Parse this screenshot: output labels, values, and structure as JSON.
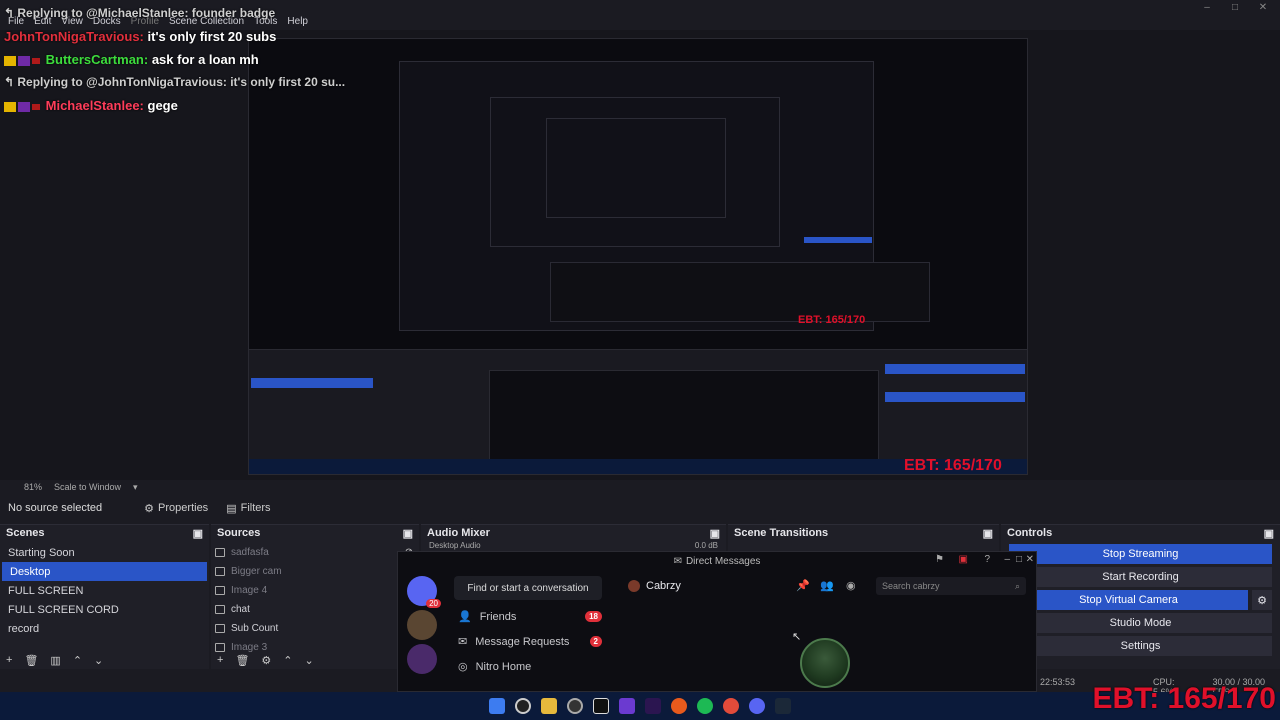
{
  "window": {
    "title": ""
  },
  "menu": {
    "items": [
      "File",
      "Edit",
      "View",
      "Docks",
      "Profile",
      "Scene Collection",
      "Tools",
      "Help"
    ]
  },
  "chat": {
    "reply1": "Replying to @MichaelStanlee: founder badge",
    "line1_user": "JohnTonNigaTravious:",
    "line1_msg": "it's only first 20 subs",
    "line2_user": "ButtersCartman:",
    "line2_msg": "ask for a loan mh",
    "reply2": "Replying to @JohnTonNigaTravious: it's only first 20 su...",
    "line3_user": "MichaelStanlee:",
    "line3_msg": "gege"
  },
  "preview": {
    "ebt_small": "EBT: 165/170",
    "zoom": "81%",
    "scale_mode": "Scale to Window"
  },
  "source_bar": {
    "no_source": "No source selected",
    "properties": "Properties",
    "filters": "Filters"
  },
  "scenes": {
    "title": "Scenes",
    "items": [
      "Starting Soon",
      "Desktop",
      "FULL SCREEN",
      "FULL SCREEN CORD",
      "record"
    ],
    "selected": "Desktop"
  },
  "sources": {
    "title": "Sources",
    "items": [
      "sadfasfa",
      "Bigger cam",
      "Image 4",
      "chat",
      "Sub Count",
      "Image 3"
    ]
  },
  "audio_mixer": {
    "title": "Audio Mixer",
    "first_channel": "Desktop Audio",
    "level": "0.0 dB"
  },
  "scene_transitions": {
    "title": "Scene Transitions"
  },
  "controls": {
    "title": "Controls",
    "buttons": [
      "Stop Streaming",
      "Start Recording",
      "Stop Virtual Camera",
      "Studio Mode",
      "Settings"
    ]
  },
  "discord": {
    "title": "Direct Messages",
    "find": "Find or start a conversation",
    "nav": [
      {
        "label": "Friends",
        "badge": "18"
      },
      {
        "label": "Message Requests",
        "badge": "2"
      },
      {
        "label": "Nitro Home",
        "badge": ""
      }
    ],
    "dm_name": "Cabrzy",
    "search_placeholder": "Search cabrzy",
    "server_badge": "20"
  },
  "status": {
    "time": "22:53:53",
    "cpu": "CPU: 5.6%",
    "fps": "30.00 / 30.00 FPS"
  },
  "overlay": {
    "ebt_big": "EBT: 165/170"
  },
  "colors": {
    "accent": "#2a55c7",
    "ebt": "#e0102a",
    "taskbar": "#0b1a3a"
  }
}
